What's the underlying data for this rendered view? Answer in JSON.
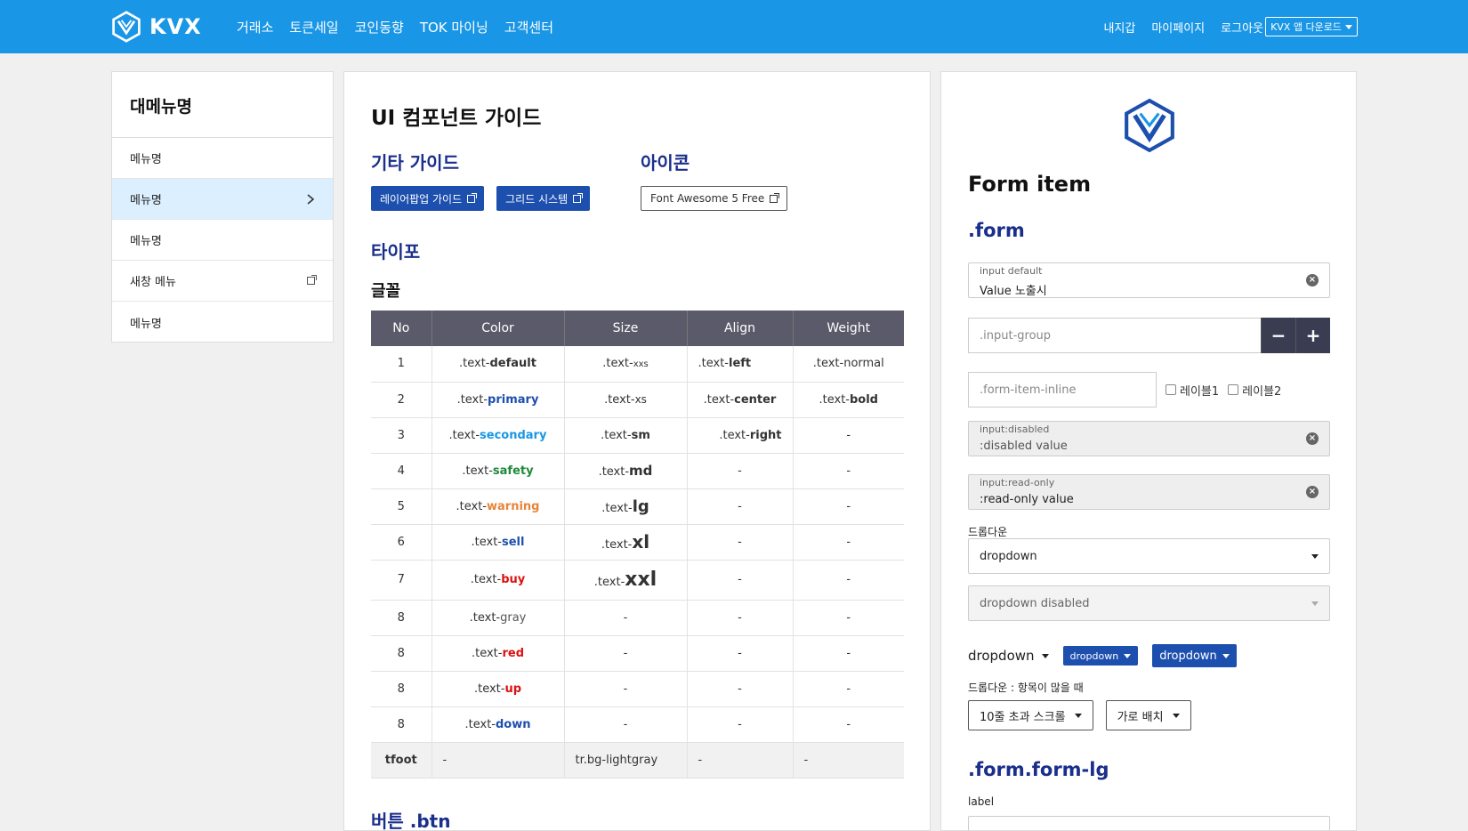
{
  "topbar": {
    "logo_text": "KVX",
    "nav": [
      "거래소",
      "토큰세일",
      "코인동향",
      "TOK 마이닝",
      "고객센터"
    ],
    "user_nav": [
      "내지갑",
      "마이페이지",
      "로그아웃"
    ],
    "app_download": "KVX 앱 다운로드"
  },
  "sidebar": {
    "title": "대메뉴명",
    "items": [
      {
        "label": "메뉴명"
      },
      {
        "label": "메뉴명"
      },
      {
        "label": "메뉴명"
      },
      {
        "label": "새창 메뉴"
      },
      {
        "label": "메뉴명"
      }
    ]
  },
  "center": {
    "title": "UI 컴포넌트 가이드",
    "etc_title": "기타 가이드",
    "etc_buttons": [
      "레이어팝업 가이드",
      "그리드 시스템"
    ],
    "icon_title": "아이콘",
    "icon_button": "Font Awesome 5 Free",
    "typo_title": "타이포",
    "font_title": "글꼴",
    "table_headers": [
      "No",
      "Color",
      "Size",
      "Align",
      "Weight"
    ],
    "rows": [
      {
        "no": "1",
        "color_pre": ".text-",
        "color": "default",
        "size_pre": ".text-",
        "size": "xxs",
        "align_pre": ".text-",
        "align": "left",
        "weight_pre": ".text-",
        "weight": "normal"
      },
      {
        "no": "2",
        "color_pre": ".text-",
        "color": "primary",
        "size_pre": ".text-",
        "size": "xs",
        "align_pre": ".text-",
        "align": "center",
        "weight_pre": ".text-",
        "weight": "bold"
      },
      {
        "no": "3",
        "color_pre": ".text-",
        "color": "secondary",
        "size_pre": ".text-",
        "size": "sm",
        "align_pre": ".text-",
        "align": "right",
        "weight": "-"
      },
      {
        "no": "4",
        "color_pre": ".text-",
        "color": "safety",
        "size_pre": ".text-",
        "size": "md",
        "align": "-",
        "weight": "-"
      },
      {
        "no": "5",
        "color_pre": ".text-",
        "color": "warning",
        "size_pre": ".text-",
        "size": "lg",
        "align": "-",
        "weight": "-"
      },
      {
        "no": "6",
        "color_pre": ".text-",
        "color": "sell",
        "size_pre": ".text-",
        "size": "xl",
        "align": "-",
        "weight": "-"
      },
      {
        "no": "7",
        "color_pre": ".text-",
        "color": "buy",
        "size_pre": ".text-",
        "size": "xxl",
        "align": "-",
        "weight": "-"
      },
      {
        "no": "8",
        "color_pre": ".text-",
        "color": "gray",
        "size": "-",
        "align": "-",
        "weight": "-"
      },
      {
        "no": "8",
        "color_pre": ".text-",
        "color": "red",
        "size": "-",
        "align": "-",
        "weight": "-"
      },
      {
        "no": "8",
        "color_pre": ".text-",
        "color": "up",
        "size": "-",
        "align": "-",
        "weight": "-"
      },
      {
        "no": "8",
        "color_pre": ".text-",
        "color": "down",
        "size": "-",
        "align": "-",
        "weight": "-"
      }
    ],
    "foot": {
      "no": "tfoot",
      "color": "-",
      "size": "tr.bg-lightgray",
      "align": "-",
      "weight": "-"
    },
    "btn_title": "버튼 .btn"
  },
  "right": {
    "title": "Form item",
    "form_title": ".form",
    "input_default": {
      "label": "input default",
      "value": "Value 노출시"
    },
    "input_group": {
      "placeholder": ".input-group",
      "minus": "−",
      "plus": "+"
    },
    "inline": {
      "placeholder": ".form-item-inline",
      "check1": "레이블1",
      "check2": "레이블2"
    },
    "input_disabled": {
      "label": "input:disabled",
      "value": ":disabled value"
    },
    "input_readonly": {
      "label": "input:read-only",
      "value": ":read-only value"
    },
    "dropdown_label": "드롭다운",
    "dropdown_value": "dropdown",
    "dropdown_disabled": "dropdown disabled",
    "dd_plain": "dropdown",
    "dd_small": "dropdown",
    "dd_medium": "dropdown",
    "many_label": "드롭다운 : 항목이 많을 때",
    "many_scroll": "10줄 초과 스크롤",
    "many_horizontal": "가로 배치",
    "form_lg_title": ".form.form-lg",
    "lg_label": "label"
  },
  "colors": {
    "topbar": "#1a96e6",
    "primary": "#1d4fae",
    "heading": "#1a2e8c",
    "table_head": "#5a5a6a"
  }
}
